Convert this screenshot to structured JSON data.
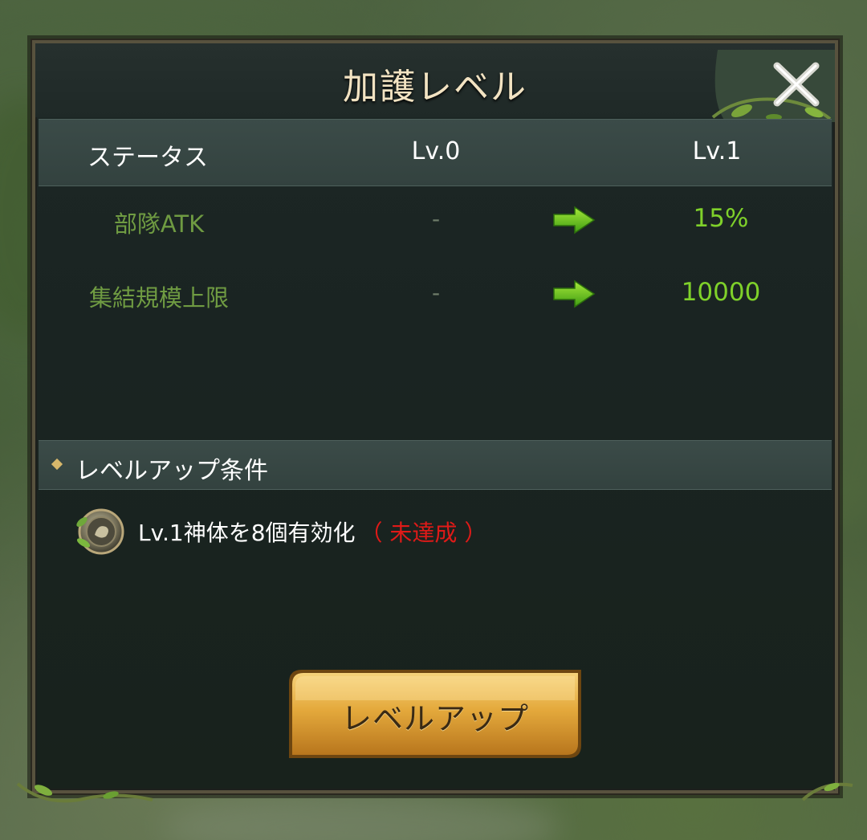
{
  "dialog": {
    "title": "加護レベル",
    "close_icon": "close-x-icon"
  },
  "stats_table": {
    "headers": {
      "status": "ステータス",
      "current_level": "Lv.0",
      "next_level": "Lv.1"
    },
    "rows": [
      {
        "name": "部隊ATK",
        "before": "-",
        "after": "15%"
      },
      {
        "name": "集結規模上限",
        "before": "-",
        "after": "10000"
      }
    ],
    "arrow_icon": "green-arrow-right-icon"
  },
  "conditions": {
    "title": "レベルアップ条件",
    "items": [
      {
        "text": "Lv.1神体を8個有効化",
        "status": "（ 未達成 ）",
        "icon": "divine-body-icon"
      }
    ]
  },
  "actions": {
    "level_up_label": "レベルアップ"
  },
  "colors": {
    "stat_name": "#6f9b42",
    "stat_after": "#7fd12a",
    "unmet_status": "#e01a18",
    "button_gold": "#e0a93e"
  }
}
